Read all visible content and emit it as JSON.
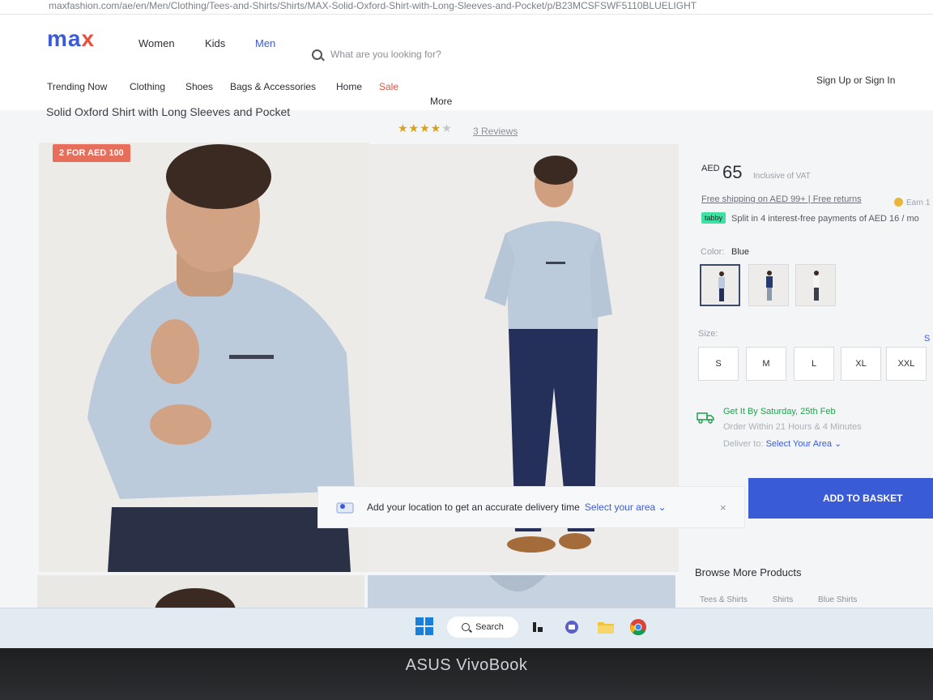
{
  "url": "maxfashion.com/ae/en/Men/Clothing/Tees-and-Shirts/Shirts/MAX-Solid-Oxford-Shirt-with-Long-Sleeves-and-Pocket/p/B23MCSFSWF5110BLUELIGHT",
  "header": {
    "logo_main": "ma",
    "logo_accent": "x",
    "nav": [
      "Women",
      "Kids",
      "Men"
    ],
    "search_placeholder": "What are you looking for?",
    "signin": "Sign Up or Sign In",
    "categories": [
      "Trending Now",
      "Clothing",
      "Shoes",
      "Bags & Accessories",
      "Home",
      "Sale",
      "More"
    ]
  },
  "product": {
    "title": "Solid Oxford Shirt with Long Sleeves and Pocket",
    "rating": 3.5,
    "rating_max": 5,
    "reviews": "3 Reviews",
    "badge": "2 FOR AED 100",
    "currency": "AED",
    "price": "65",
    "vat_note": "Inclusive of VAT",
    "shipping": "Free shipping on AED 99+ | Free returns",
    "earn": "Earn 1",
    "tabby_badge": "tabby",
    "tabby_text": "Split in 4 interest-free payments of AED 16 / mo",
    "color_label": "Color:",
    "color_value": "Blue",
    "size_label": "Size:",
    "size_guide": "S",
    "sizes": [
      "S",
      "M",
      "L",
      "XL",
      "XXL"
    ],
    "delivery_title": "Get It By Saturday, 25th Feb",
    "delivery_order": "Order Within 21 Hours & 4 Minutes",
    "deliver_to_label": "Deliver to:",
    "deliver_to_link": "Select Your Area",
    "add_to_basket": "ADD TO BASKET",
    "browse_more": "Browse More Products",
    "browse_links": [
      "Tees & Shirts",
      "Shirts",
      "Blue Shirts"
    ]
  },
  "toast": {
    "message": "Add your location to get an accurate delivery time",
    "link": "Select your area",
    "close": "×"
  },
  "taskbar": {
    "search": "Search"
  },
  "device": {
    "brand": "ASUS VivoBook"
  },
  "colors": {
    "brand_blue": "#3b5bdb",
    "brand_red": "#e8503a",
    "basket": "#3a5bd6",
    "delivery_green": "#21a04e"
  }
}
